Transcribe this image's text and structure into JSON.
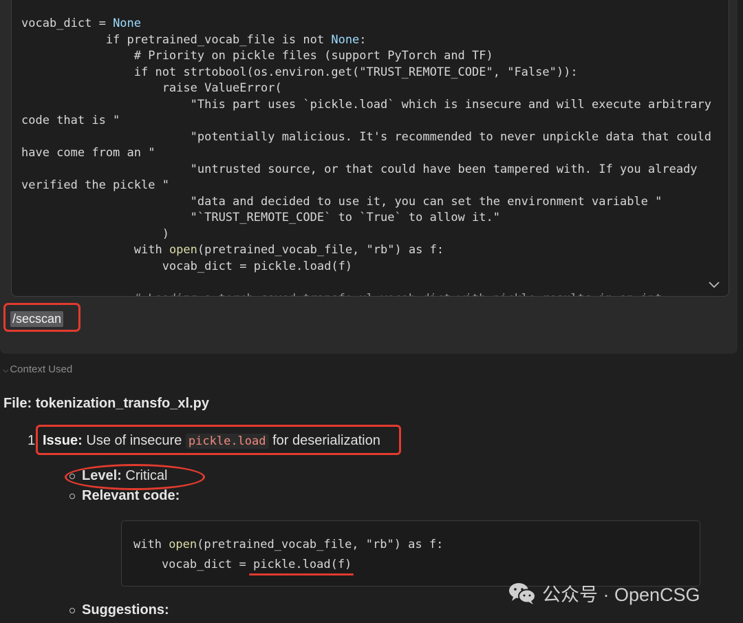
{
  "code_panel": {
    "lines": [
      {
        "t": "vocab_dict = ",
        "none": "None"
      },
      {
        "t": "            if pretrained_vocab_file is not ",
        "none": "None",
        "tail": ":"
      },
      {
        "t": "                # Priority on pickle files (support PyTorch and TF)"
      },
      {
        "t": "                if not strtobool(os.environ.get(\"TRUST_REMOTE_CODE\", \"False\")):"
      },
      {
        "t": "                    raise ValueError("
      },
      {
        "t": "                        \"This part uses `pickle.load` which is insecure and will execute arbitrary"
      },
      {
        "t": "code that is \""
      },
      {
        "t": "                        \"potentially malicious. It's recommended to never unpickle data that could"
      },
      {
        "t": "have come from an \""
      },
      {
        "t": "                        \"untrusted source, or that could have been tampered with. If you already"
      },
      {
        "t": "verified the pickle \""
      },
      {
        "t": "                        \"data and decided to use it, you can set the environment variable \""
      },
      {
        "t": "                        \"`TRUST_REMOTE_CODE` to `True` to allow it.\""
      },
      {
        "t": "                    )"
      },
      {
        "t": "                with ",
        "fn": "open",
        "tail": "(pretrained_vocab_file, \"rb\") as f:"
      },
      {
        "t": "                    vocab_dict = pickle.load(f)"
      },
      {
        "t": ""
      },
      {
        "t": "                # Loading a torch-saved transfo-xl vocab dict with pickle results in an int",
        "cut": true
      }
    ]
  },
  "command": "/secscan",
  "context_used": "Context Used",
  "file": {
    "label": "File:",
    "name": "tokenization_transfo_xl.py"
  },
  "issue": {
    "number": "1",
    "label": "Issue:",
    "text_before": "Use of insecure",
    "code": "pickle.load",
    "text_after": "for deserialization"
  },
  "level": {
    "label": "Level:",
    "value": "Critical"
  },
  "relevant_code_label": "Relevant code:",
  "relevant_code": {
    "line1_pre": "with ",
    "line1_fn": "open",
    "line1_post": "(pretrained_vocab_file, \"rb\") as f:",
    "line2_pre": "    vocab_dict = ",
    "line2_hl": "pickle.load(f)"
  },
  "suggestions_label": "Suggestions:",
  "watermark": "公众号 · OpenCSG",
  "colors": {
    "annotation_red": "#e23b2e",
    "builtin_yellow": "#dcdcaa",
    "none_blue": "#9cdcfe",
    "inline_code": "#f08a7e"
  },
  "icons": [
    "chevron-down-icon",
    "wechat-icon"
  ]
}
